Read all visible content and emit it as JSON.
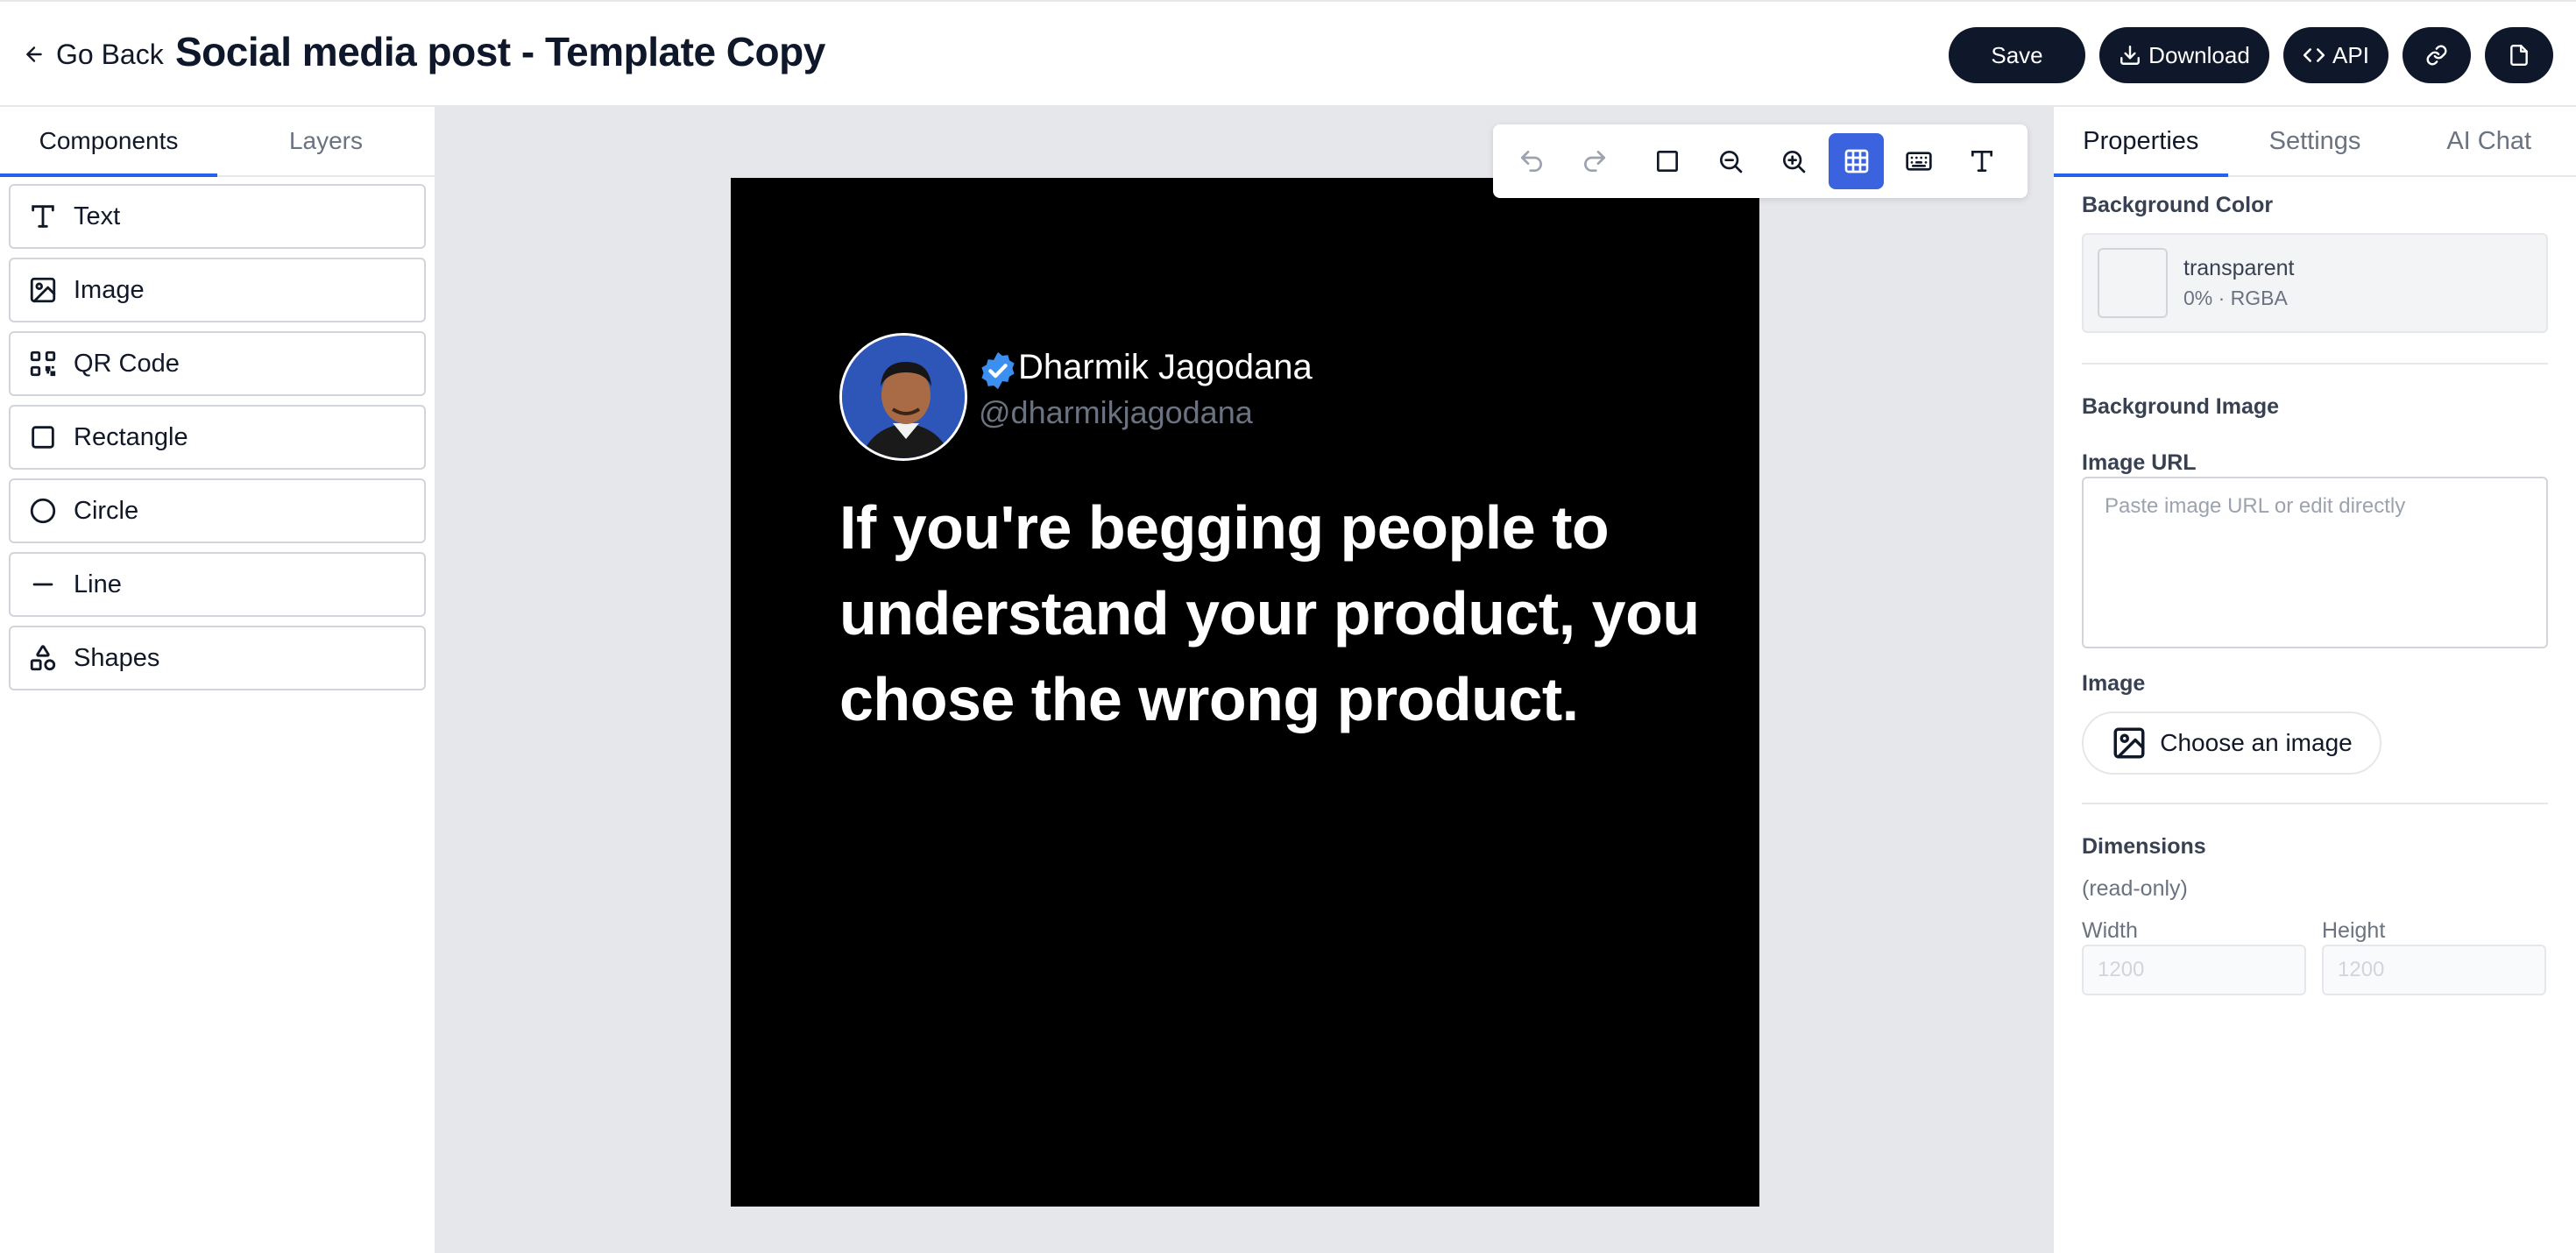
{
  "header": {
    "back_label": "Go Back",
    "title": "Social media post - Template Copy",
    "save_label": "Save",
    "download_label": "Download",
    "api_label": "API",
    "link_icon": "link-icon",
    "document_icon": "document-icon"
  },
  "left_panel": {
    "tabs": [
      "Components",
      "Layers"
    ],
    "active_tab": "Components",
    "components": [
      {
        "label": "Text",
        "icon": "text-icon"
      },
      {
        "label": "Image",
        "icon": "image-icon"
      },
      {
        "label": "QR Code",
        "icon": "qr-code-icon"
      },
      {
        "label": "Rectangle",
        "icon": "square-icon"
      },
      {
        "label": "Circle",
        "icon": "circle-icon"
      },
      {
        "label": "Line",
        "icon": "minus-icon"
      },
      {
        "label": "Shapes",
        "icon": "shapes-icon"
      }
    ]
  },
  "toolbar": {
    "buttons": [
      "undo-icon",
      "redo-icon",
      "square-icon",
      "zoom-out-icon",
      "zoom-in-icon",
      "grid-icon",
      "keyboard-icon",
      "text-icon"
    ],
    "active": "grid-icon"
  },
  "artboard": {
    "background": "#000000",
    "author_name": "Dharmik Jagodana",
    "author_handle": "@dharmikjagodana",
    "verified_color": "#3b8ff0",
    "quote": "If you're begging people to understand your product, you chose the wrong product."
  },
  "right_panel": {
    "tabs": [
      "Properties",
      "Settings",
      "AI Chat"
    ],
    "active_tab": "Properties",
    "background_color_label": "Background Color",
    "background_color_value": "transparent",
    "background_color_meta": "0% · RGBA",
    "background_image_label": "Background Image",
    "image_url_label": "Image URL",
    "image_url_placeholder": "Paste image URL or edit directly",
    "image_label": "Image",
    "choose_image_label": "Choose an image",
    "dimensions_label": "Dimensions",
    "dimensions_note": "(read-only)",
    "width_label": "Width",
    "height_label": "Height",
    "width_value": "1200",
    "height_value": "1200"
  },
  "colors": {
    "accent": "#2563eb",
    "dark_button": "#0f172a",
    "canvas_bg": "#e5e7eb"
  }
}
